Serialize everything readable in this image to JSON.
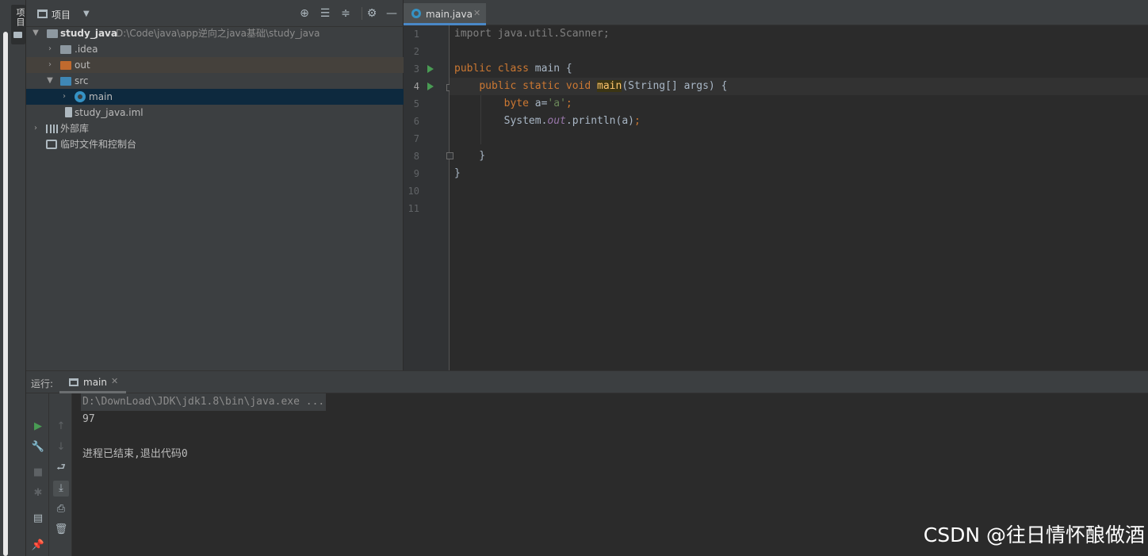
{
  "left_strip": {
    "tab_label": "项目"
  },
  "project": {
    "title": "项目",
    "tree": [
      {
        "label": "study_java",
        "path": "D:\\Code\\java\\app逆向之java基础\\study_java"
      },
      {
        "label": ".idea"
      },
      {
        "label": "out"
      },
      {
        "label": "src"
      },
      {
        "label": "main"
      },
      {
        "label": "study_java.iml"
      },
      {
        "label": "外部库"
      },
      {
        "label": "临时文件和控制台"
      }
    ]
  },
  "editor": {
    "tab": "main.java",
    "line_numbers": [
      "1",
      "2",
      "3",
      "4",
      "5",
      "6",
      "7",
      "8",
      "9",
      "10",
      "11"
    ]
  },
  "run": {
    "title": "运行:",
    "tab": "main",
    "command": "D:\\DownLoad\\JDK\\jdk1.8\\bin\\java.exe ...",
    "output": "97",
    "exit": "进程已结束,退出代码0"
  },
  "watermark": "CSDN @往日情怀酿做酒"
}
